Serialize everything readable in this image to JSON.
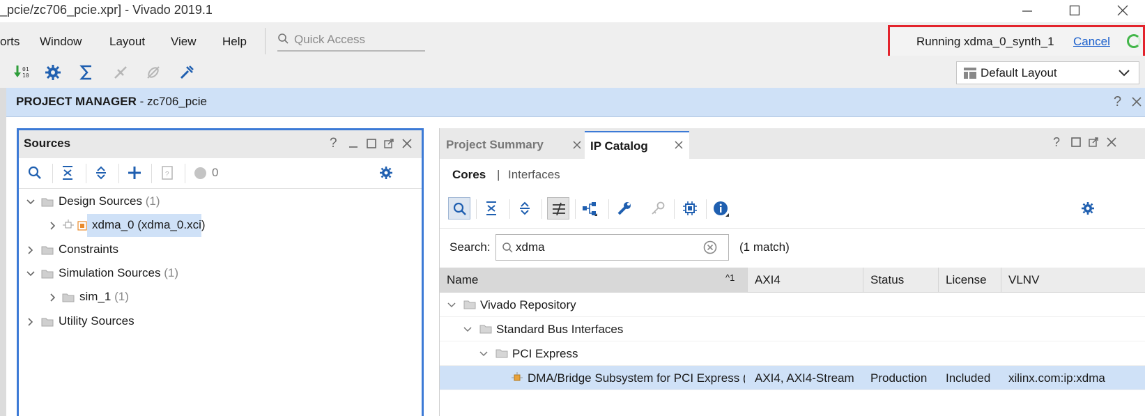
{
  "window": {
    "title": "_pcie/zc706_pcie.xpr] - Vivado 2019.1"
  },
  "menu": {
    "items": [
      {
        "label": "orts"
      },
      {
        "label": "Window"
      },
      {
        "label": "Layout"
      },
      {
        "label": "View"
      },
      {
        "label": "Help"
      }
    ],
    "quick_access_placeholder": "Quick Access"
  },
  "status": {
    "running_text": "Running xdma_0_synth_1",
    "cancel_label": "Cancel",
    "highlight_color": "#e3232c",
    "spinner_color": "#42b649"
  },
  "toolbar": {
    "layout_selected": "Default Layout"
  },
  "project_manager": {
    "title_bold": "PROJECT MANAGER",
    "title_rest": " - zc706_pcie",
    "header_color": "#cfe1f7"
  },
  "sources": {
    "title": "Sources",
    "count_badge": "0",
    "tree": {
      "design_sources": {
        "label": "Design Sources",
        "count": "(1)"
      },
      "xdma": {
        "label": "xdma_0 (xdma_0.xci)"
      },
      "constraints": {
        "label": "Constraints"
      },
      "simulation_sources": {
        "label": "Simulation Sources",
        "count": "(1)"
      },
      "sim_1": {
        "label": "sim_1",
        "count": "(1)"
      },
      "utility_sources": {
        "label": "Utility Sources"
      }
    },
    "focus_border_color": "#3c7ad6"
  },
  "ip_catalog": {
    "tabs": [
      {
        "label": "Project Summary",
        "active": false
      },
      {
        "label": "IP Catalog",
        "active": true
      }
    ],
    "subtabs": {
      "cores": "Cores",
      "separator": "|",
      "interfaces": "Interfaces"
    },
    "search": {
      "label": "Search:",
      "value": "xdma",
      "match_text": "(1 match)"
    },
    "columns": {
      "name": "Name",
      "sort_indicator": "^1",
      "axi4": "AXI4",
      "status": "Status",
      "license": "License",
      "vlnv": "VLNV"
    },
    "rows": {
      "repo": "Vivado Repository",
      "sbi": "Standard Bus Interfaces",
      "pcie": "PCI Express",
      "dma": {
        "name": "DMA/Bridge Subsystem for PCI Express (",
        "axi4": "AXI4, AXI4-Stream",
        "status": "Production",
        "license": "Included",
        "vlnv": "xilinx.com:ip:xdma"
      }
    }
  }
}
